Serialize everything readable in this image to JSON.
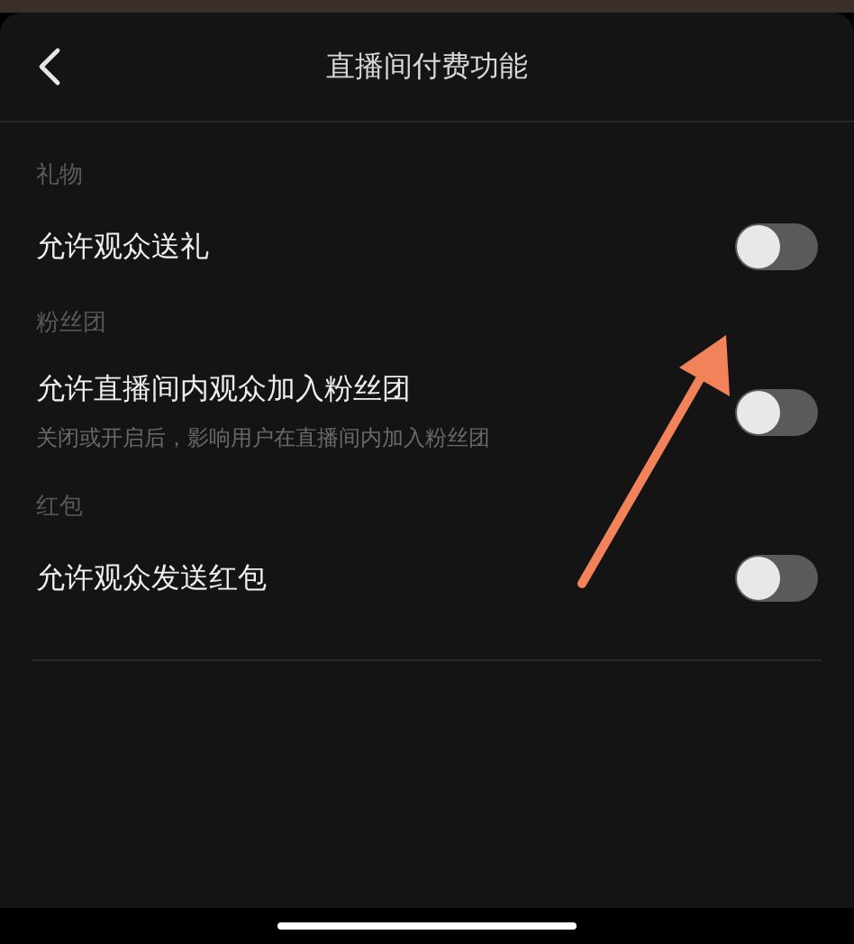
{
  "header": {
    "title": "直播间付费功能"
  },
  "sections": [
    {
      "heading": "礼物",
      "items": [
        {
          "label": "允许观众送礼",
          "on": false
        }
      ]
    },
    {
      "heading": "粉丝团",
      "items": [
        {
          "label": "允许直播间内观众加入粉丝团",
          "description": "关闭或开启后，影响用户在直播间内加入粉丝团",
          "on": false
        }
      ]
    },
    {
      "heading": "红包",
      "items": [
        {
          "label": "允许观众发送红包",
          "on": false
        }
      ]
    }
  ]
}
